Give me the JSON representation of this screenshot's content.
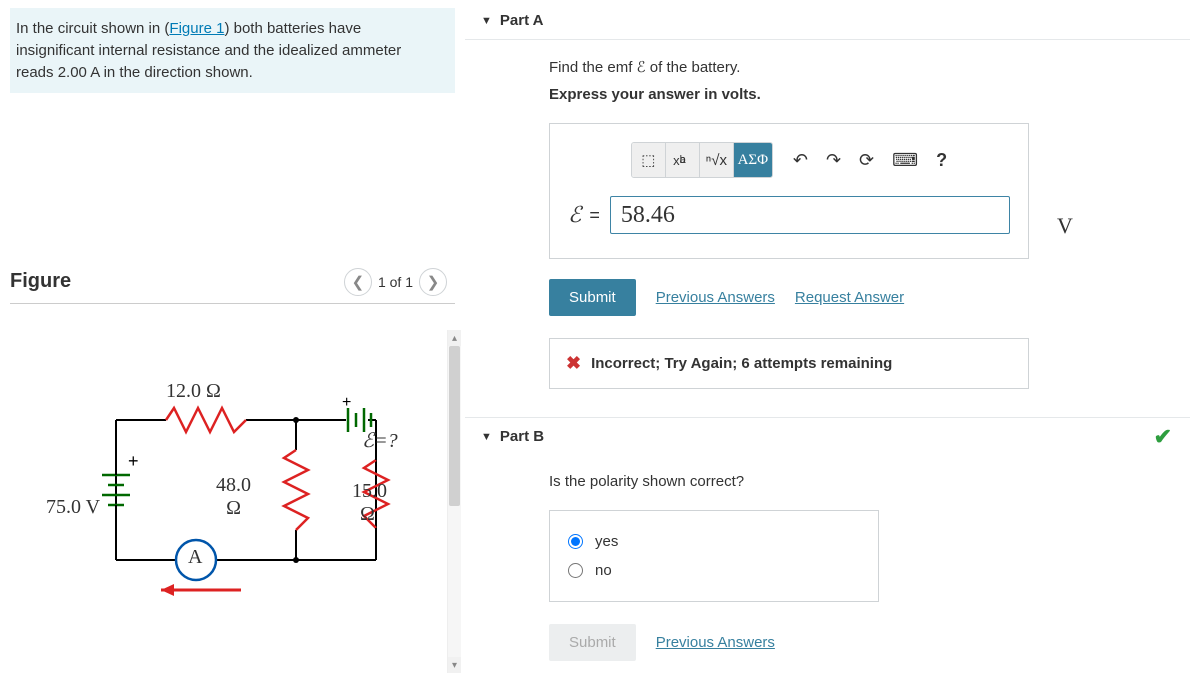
{
  "problem": {
    "prefix": "In the circuit shown in (",
    "figure_link": "Figure 1",
    "suffix": ") both batteries have insignificant internal resistance and the idealized ammeter reads 2.00 A in the direction shown."
  },
  "figure": {
    "title": "Figure",
    "nav_label": "1 of 1",
    "labels": {
      "r1": "12.0 Ω",
      "r2": "48.0",
      "r2_unit": "Ω",
      "r3": "15.0",
      "r3_unit": "Ω",
      "v1": "75.0 V",
      "emf": "ℰ=?",
      "ammeter": "A"
    }
  },
  "partA": {
    "title": "Part A",
    "instr": "Find the emf ℰ of the battery.",
    "bold_instr": "Express your answer in volts.",
    "toolbar": {
      "templates": "⬚",
      "fraction": "√",
      "symbols": "ΑΣΦ",
      "undo": "↶",
      "redo": "↷",
      "reset": "⟳",
      "keyboard": "⌨",
      "help": "?"
    },
    "eq_symbol": "ℰ",
    "eq_sign": "=",
    "answer_value": "58.46",
    "unit": "V",
    "submit_label": "Submit",
    "prev_answers": "Previous Answers",
    "request_answer": "Request Answer",
    "feedback": "Incorrect; Try Again; 6 attempts remaining"
  },
  "partB": {
    "title": "Part B",
    "instr": "Is the polarity shown correct?",
    "opt_yes": "yes",
    "opt_no": "no",
    "submit_label": "Submit",
    "prev_answers": "Previous Answers"
  }
}
